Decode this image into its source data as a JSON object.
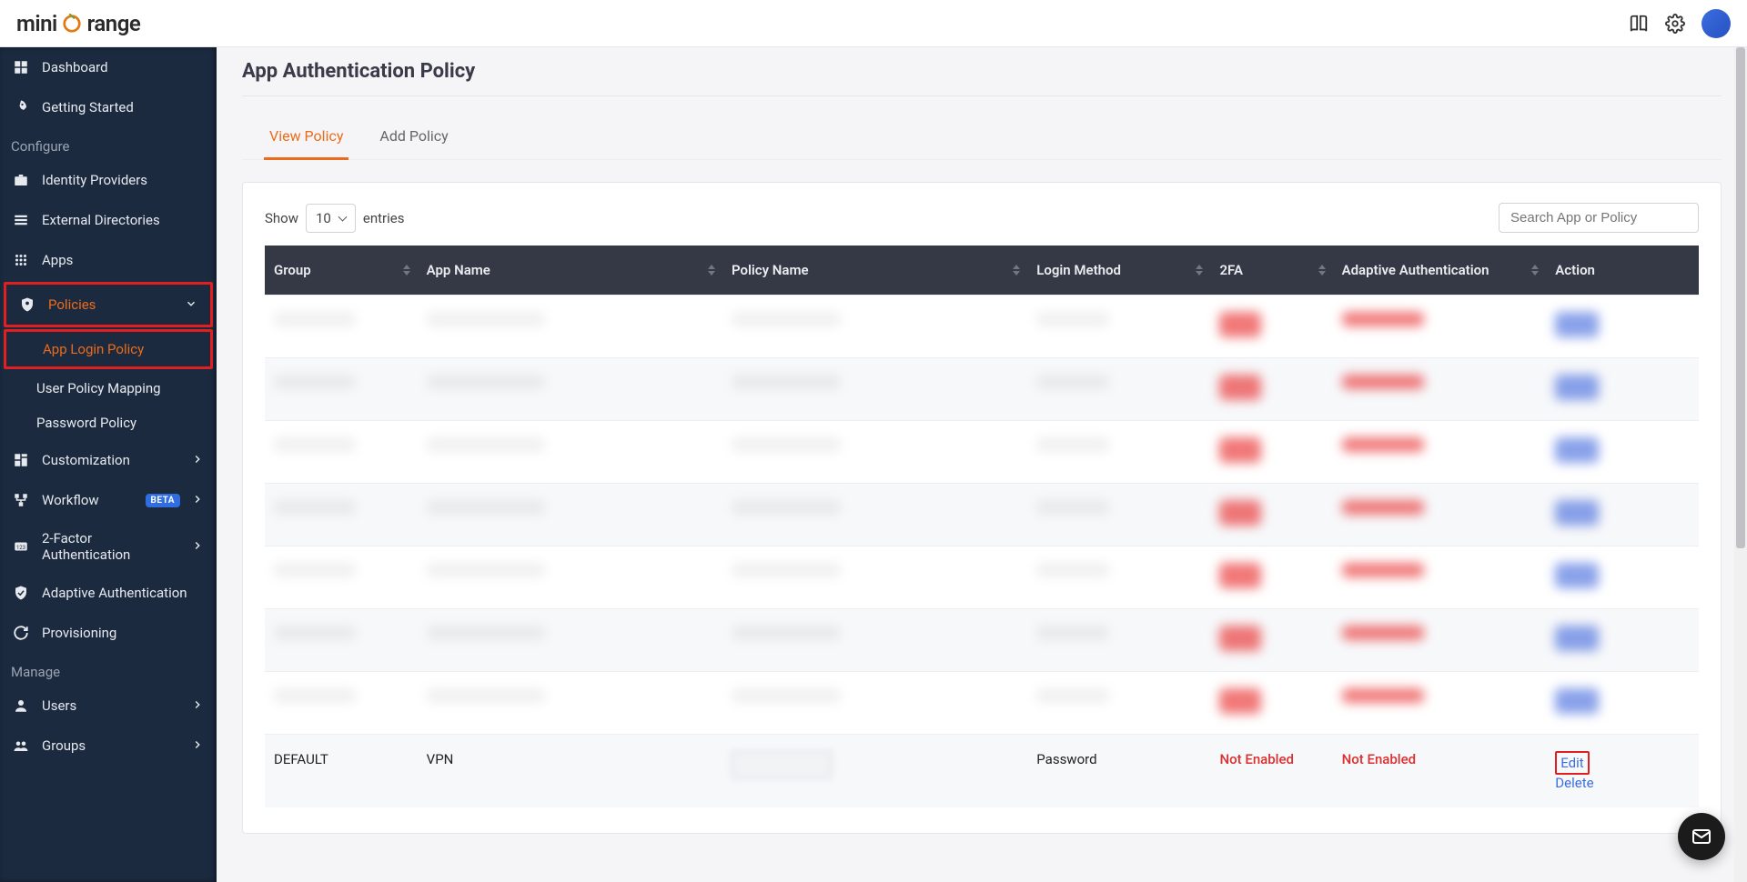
{
  "brand": {
    "name_pre": "mini",
    "name_mid": "o",
    "name_post": "range"
  },
  "topbar": {
    "book_icon": "book-icon",
    "gear_icon": "gear-icon"
  },
  "sidebar": {
    "items_top": [
      {
        "icon": "dashboard-icon",
        "label": "Dashboard"
      },
      {
        "icon": "rocket-icon",
        "label": "Getting Started"
      }
    ],
    "section_configure": "Configure",
    "items_configure": [
      {
        "icon": "briefcase-icon",
        "label": "Identity Providers"
      },
      {
        "icon": "list-icon",
        "label": "External Directories"
      },
      {
        "icon": "apps-icon",
        "label": "Apps"
      }
    ],
    "policies": {
      "icon": "shield-icon",
      "label": "Policies",
      "subs": [
        {
          "label": "App Login Policy",
          "active": true
        },
        {
          "label": "User Policy Mapping"
        },
        {
          "label": "Password Policy"
        }
      ]
    },
    "items_mid": [
      {
        "icon": "customize-icon",
        "label": "Customization",
        "chev": true
      },
      {
        "icon": "workflow-icon",
        "label": "Workflow",
        "chev": true,
        "badge": "BETA"
      },
      {
        "icon": "twofa-icon",
        "label": "2-Factor Authentication",
        "chev": true
      },
      {
        "icon": "shield-check-icon",
        "label": "Adaptive Authentication"
      },
      {
        "icon": "sync-icon",
        "label": "Provisioning"
      }
    ],
    "section_manage": "Manage",
    "items_manage": [
      {
        "icon": "user-icon",
        "label": "Users",
        "chev": true
      },
      {
        "icon": "groups-icon",
        "label": "Groups",
        "chev": true
      }
    ]
  },
  "page": {
    "title": "App Authentication Policy",
    "tabs": [
      {
        "label": "View Policy",
        "active": true
      },
      {
        "label": "Add Policy"
      }
    ],
    "show_label": "Show",
    "show_value": "10",
    "entries_label": "entries",
    "search_placeholder": "Search App or Policy"
  },
  "table": {
    "headers": {
      "group": "Group",
      "app": "App Name",
      "policy": "Policy Name",
      "login": "Login Method",
      "twofa": "2FA",
      "adaptive": "Adaptive Authentication",
      "action": "Action"
    },
    "visible_row": {
      "group": "DEFAULT",
      "app": "VPN",
      "policy": "",
      "login": "Password",
      "twofa": "Not Enabled",
      "adaptive": "Not Enabled",
      "edit": "Edit",
      "delete": "Delete"
    }
  }
}
